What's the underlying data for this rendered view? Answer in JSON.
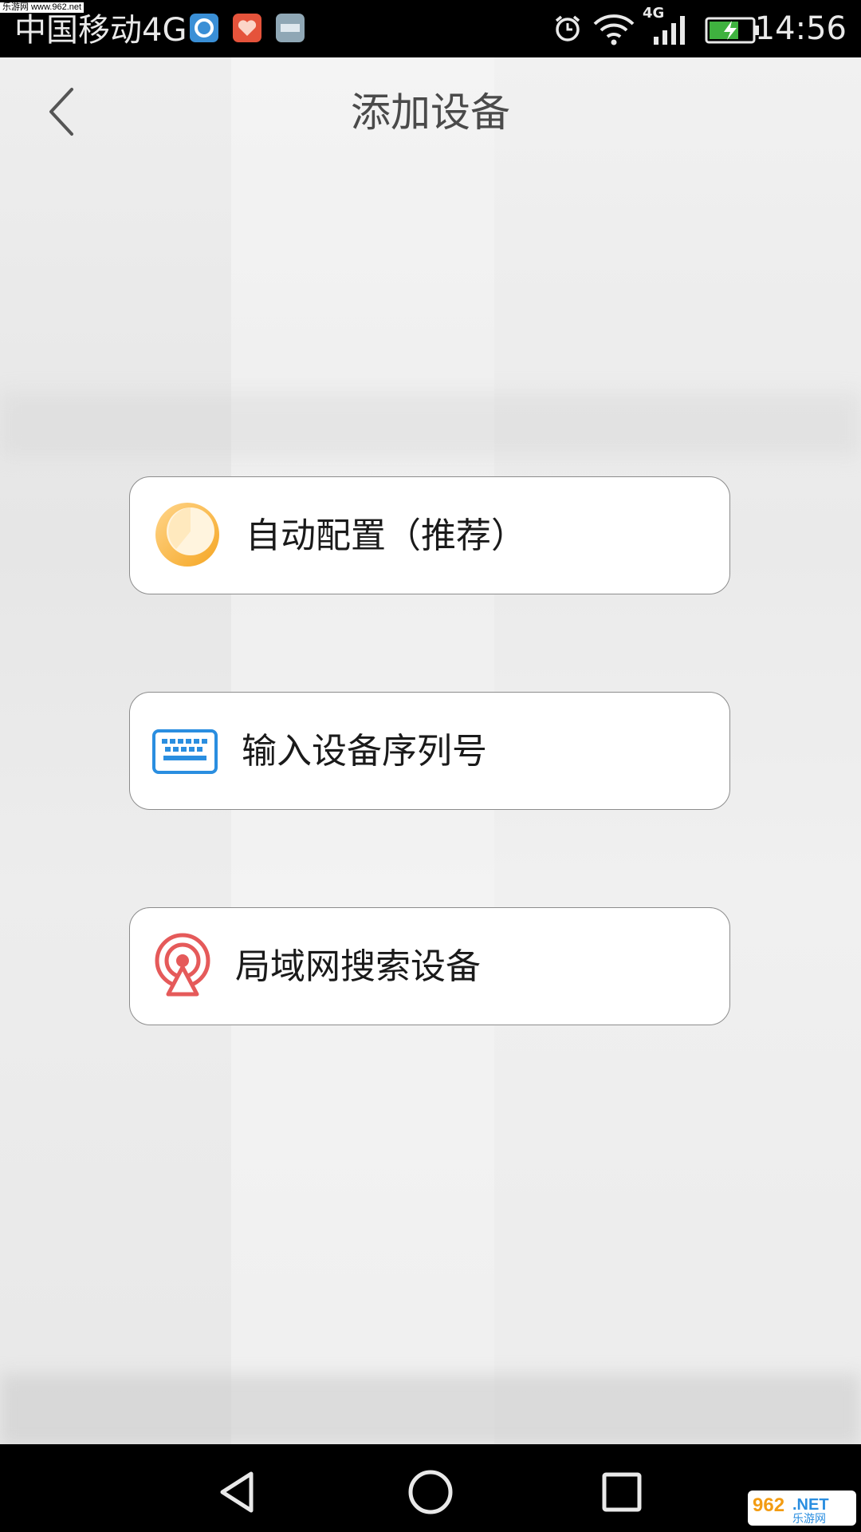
{
  "status_bar": {
    "watermark": "乐游网 www.962.net",
    "carrier": "中国移动4G",
    "network_badge": "4G",
    "time": "14:56",
    "notification_icons": [
      "browser-app-icon",
      "health-app-icon",
      "vota-app-icon"
    ],
    "system_icons": [
      "alarm-icon",
      "wifi-icon",
      "signal-icon",
      "battery-charging-icon"
    ]
  },
  "header": {
    "title": "添加设备",
    "back_icon": "chevron-left-icon"
  },
  "options": [
    {
      "label": "自动配置（推荐）",
      "icon": "auto-config-icon",
      "icon_color": "#f5a623"
    },
    {
      "label": "输入设备序列号",
      "icon": "keyboard-icon",
      "icon_color": "#2a8ee0"
    },
    {
      "label": "局域网搜索设备",
      "icon": "lan-search-icon",
      "icon_color": "#e55a5a"
    }
  ],
  "nav_bar": {
    "buttons": [
      "nav-back-icon",
      "nav-home-icon",
      "nav-recent-icon"
    ]
  },
  "watermark_bottom": "962.NET 乐游网",
  "colors": {
    "status_bar_bg": "#000000",
    "title_text": "#4a4a4a",
    "card_border": "#8c8c8c",
    "card_bg": "#ffffff"
  }
}
